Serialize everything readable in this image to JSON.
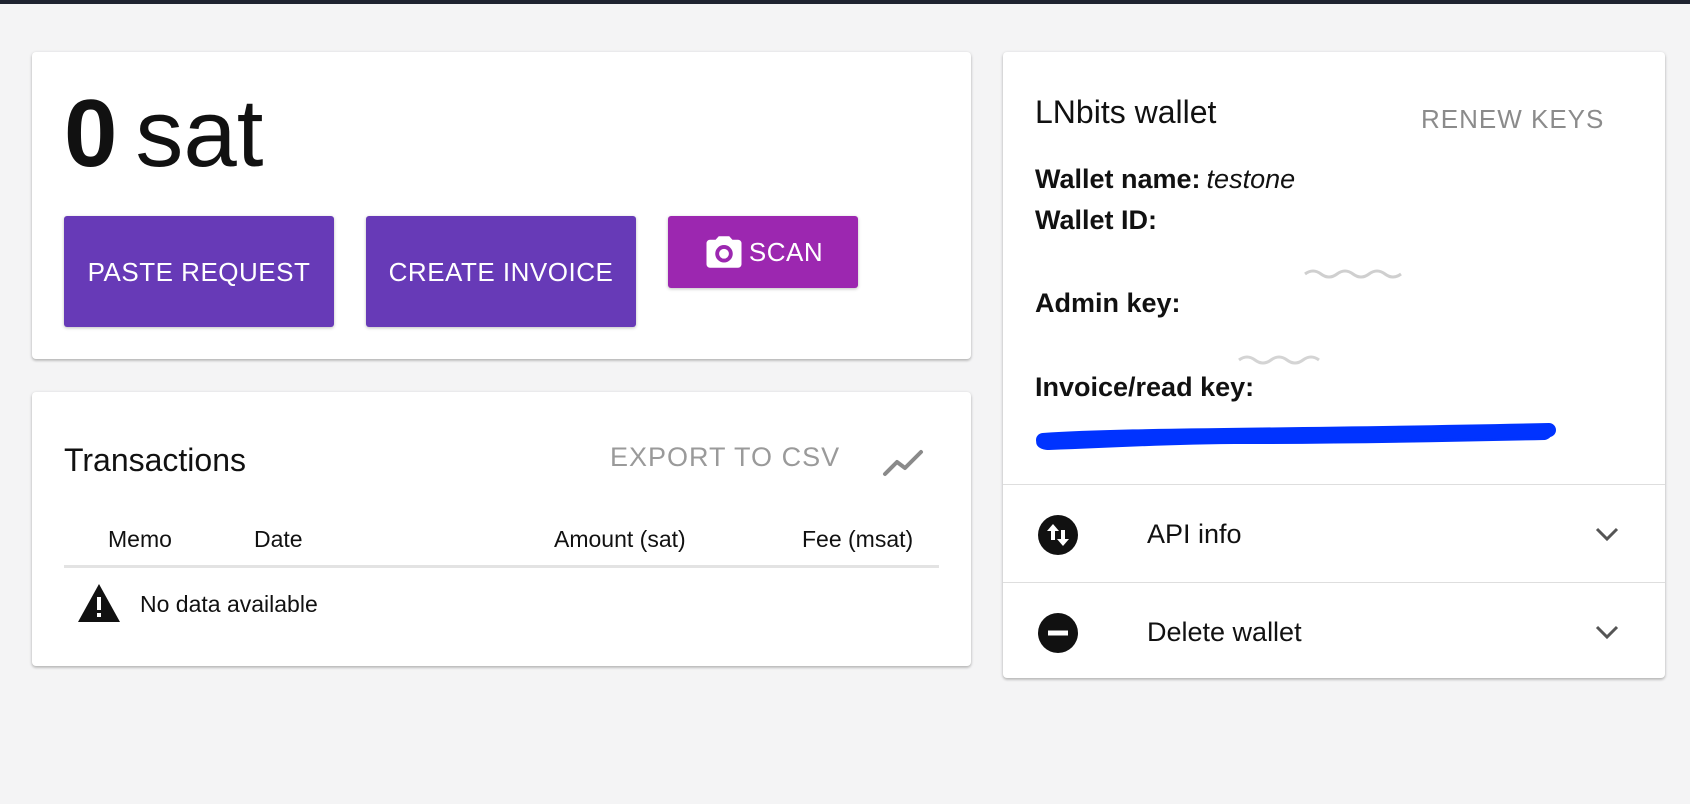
{
  "balance": {
    "amount": "0",
    "unit": "sat"
  },
  "actions": {
    "paste_request": "PASTE REQUEST",
    "create_invoice": "CREATE INVOICE",
    "scan": "SCAN",
    "scan_icon": "camera-icon"
  },
  "transactions": {
    "title": "Transactions",
    "export_label": "EXPORT TO CSV",
    "chart_icon": "chart-line-icon",
    "columns": [
      "Memo",
      "Date",
      "Amount (sat)",
      "Fee (msat)"
    ],
    "empty_message": "No data available",
    "empty_icon": "warning-icon"
  },
  "wallet": {
    "title": "LNbits wallet",
    "renew_label": "RENEW KEYS",
    "name_label": "Wallet name:",
    "name_value": "testone",
    "id_label": "Wallet ID:",
    "admin_key_label": "Admin key:",
    "invoice_key_label": "Invoice/read key:",
    "rows": [
      {
        "label": "API info",
        "icon": "swap-vertical-icon"
      },
      {
        "label": "Delete wallet",
        "icon": "remove-circle-icon"
      }
    ]
  },
  "colors": {
    "primary": "#673ab7",
    "accent": "#9c27b0",
    "redaction": "#0033ff",
    "background": "#f4f4f5"
  }
}
